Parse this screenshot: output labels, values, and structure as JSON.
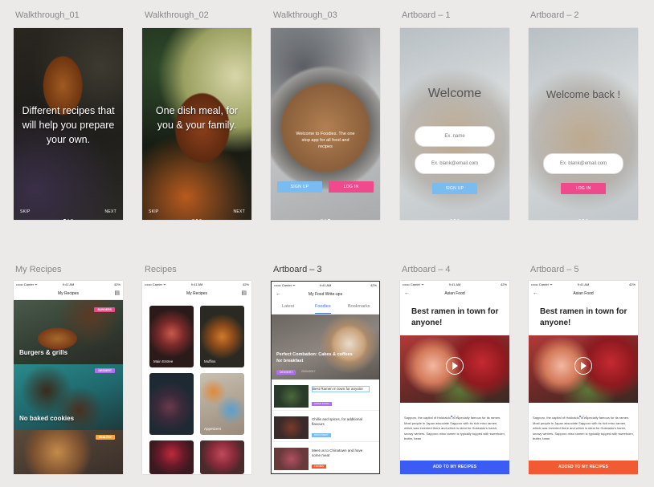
{
  "artboards": {
    "row1": [
      {
        "label": "Walkthrough_01",
        "text": "Different recipes that will help you prepare your own.",
        "skip": "SKIP",
        "next": "NEXT"
      },
      {
        "label": "Walkthrough_02",
        "text": "One dish meal, for you & your family.",
        "skip": "SKIP",
        "next": "NEXT"
      },
      {
        "label": "Walkthrough_03",
        "text": "Welcome to Foodies. The one stop app for all food and recipes",
        "signup": "SIGN UP",
        "login": "LOG IN"
      },
      {
        "label": "Artboard – 1",
        "welcome": "Welcome",
        "name_placeholder": "Ex. name",
        "email_placeholder": "Ex. blank@email.com",
        "button": "SIGN UP"
      },
      {
        "label": "Artboard – 2",
        "welcome": "Welcome back !",
        "email_placeholder": "Ex. blank@email.com",
        "button": "LOG IN"
      }
    ],
    "row2": [
      {
        "label": "My Recipes",
        "nav_title": "My Recipes",
        "tiles": [
          {
            "title": "Burgers & grills",
            "tag": "BURGERS"
          },
          {
            "title": "No baked cookies",
            "tag": "DESSERT"
          },
          {
            "title": "",
            "tag": "HEALTHY"
          }
        ]
      },
      {
        "label": "Recipes",
        "nav_title": "My Recipes",
        "cards": [
          "Main Entree",
          "Muffins",
          "",
          "Appetizers",
          "",
          ""
        ]
      },
      {
        "label": "Artboard – 3",
        "nav_title": "My Food Write-ups",
        "tabs": [
          "Latest",
          "Foodies",
          "Bookmarks"
        ],
        "hero_title": "Perfect Combation: Cakes & coffees for breakfast",
        "hero_tag": "DESSERT",
        "hero_date": "20/04/2017",
        "rows": [
          {
            "text": "Best Ramen in town for anyone",
            "tag": "ASIAN FOOD"
          },
          {
            "text": "Chillis and spices, for additional flavours",
            "tag": "DISCOVERY"
          },
          {
            "text": "Meet us to Chinatown and have some meat",
            "tag": "FROZEN"
          }
        ]
      },
      {
        "label": "Artboard – 4",
        "nav_title": "Asian Food",
        "title": "Best ramen in town for anyone!",
        "body": "Sapporo, the capital of Hokkaido, is especially famous for its ramen. Most people in Japan associate Sapporo with its rich miso ramen, which was invented there and which is ideal for Hokkaido's harsh, snowy winters. Sapporo miso ramen is typically topped with sweetcorn, butter, bean",
        "button": "ADD TO MY RECIPES"
      },
      {
        "label": "Artboard – 5",
        "nav_title": "Asian Food",
        "title": "Best ramen in town for anyone!",
        "body": "Sapporo, the capital of Hokkaido, is especially famous for its ramen. Most people in Japan associate Sapporo with its rich miso ramen, which was invented there and which is ideal for Hokkaido's harsh, snowy winters. Sapporo miso ramen is typically topped with sweetcorn, butter, bean",
        "button": "ADDED TO MY RECIPES"
      }
    ]
  },
  "status_bar": {
    "carrier": "•••oo Carrier ᯤ",
    "time": "9:41 AM",
    "battery": "42%"
  },
  "colors": {
    "blue": "#7bbcf0",
    "pink": "#ee4a8c",
    "purple": "#b26ef0",
    "orange": "#f7a83a",
    "primary_blue": "#3a5cf5",
    "added_orange": "#f25a32"
  }
}
